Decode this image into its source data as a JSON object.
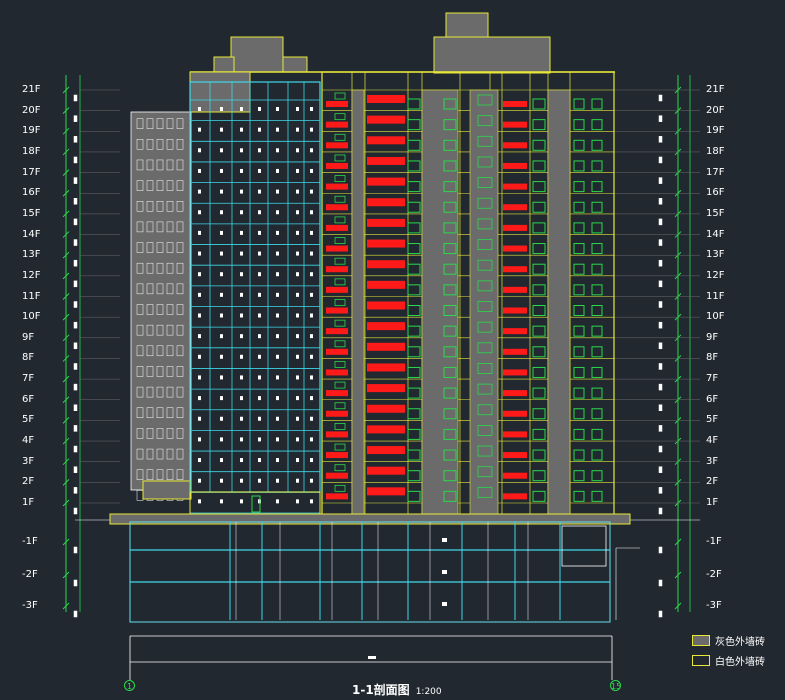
{
  "floors_above": [
    "21F",
    "20F",
    "19F",
    "18F",
    "17F",
    "16F",
    "15F",
    "14F",
    "13F",
    "12F",
    "11F",
    "10F",
    "9F",
    "8F",
    "7F",
    "6F",
    "5F",
    "4F",
    "3F",
    "2F",
    "1F"
  ],
  "floors_below": [
    "-1F",
    "-2F",
    "-3F"
  ],
  "legend": [
    {
      "label": "灰色外墙砖",
      "color": "#6b6b6b"
    },
    {
      "label": "白色外墙砖",
      "color": "#212830"
    }
  ],
  "title": "1-1剖面图",
  "scale": "1:200",
  "axis_left": "1",
  "axis_right": "15",
  "colors": {
    "background": "#212830",
    "yellow": "#e8e83a",
    "cyan": "#3fd8e8",
    "red": "#ff1a1a",
    "green": "#2bd94a",
    "gray": "#6b6b6b",
    "white": "#ffffff"
  }
}
